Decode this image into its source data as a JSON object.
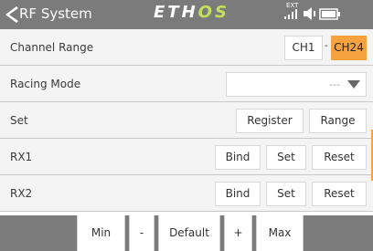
{
  "header": {
    "title": "RF System",
    "logo_white": "ETH",
    "logo_green": "OS",
    "ext_label": "EXT",
    "icons": [
      "back-arrow-icon",
      "signal-icon",
      "speaker-icon",
      "battery-icon"
    ]
  },
  "rows": {
    "channel_range": {
      "label": "Channel Range",
      "start": "CH1",
      "separator": "-",
      "end": "CH24"
    },
    "racing_mode": {
      "label": "Racing Mode",
      "value": "---"
    },
    "set": {
      "label": "Set",
      "register": "Register",
      "range": "Range"
    },
    "rx1": {
      "label": "RX1",
      "bind": "Bind",
      "set": "Set",
      "reset": "Reset"
    },
    "rx2": {
      "label": "RX2",
      "bind": "Bind",
      "set": "Set",
      "reset": "Reset"
    }
  },
  "footer": {
    "min": "Min",
    "minus": "-",
    "default": "Default",
    "plus": "+",
    "max": "Max"
  },
  "colors": {
    "bar": "#7b7b7b",
    "accent": "#f7a23f",
    "logo_green": "#c3e05a",
    "row_bg": "#f4f4f4"
  }
}
